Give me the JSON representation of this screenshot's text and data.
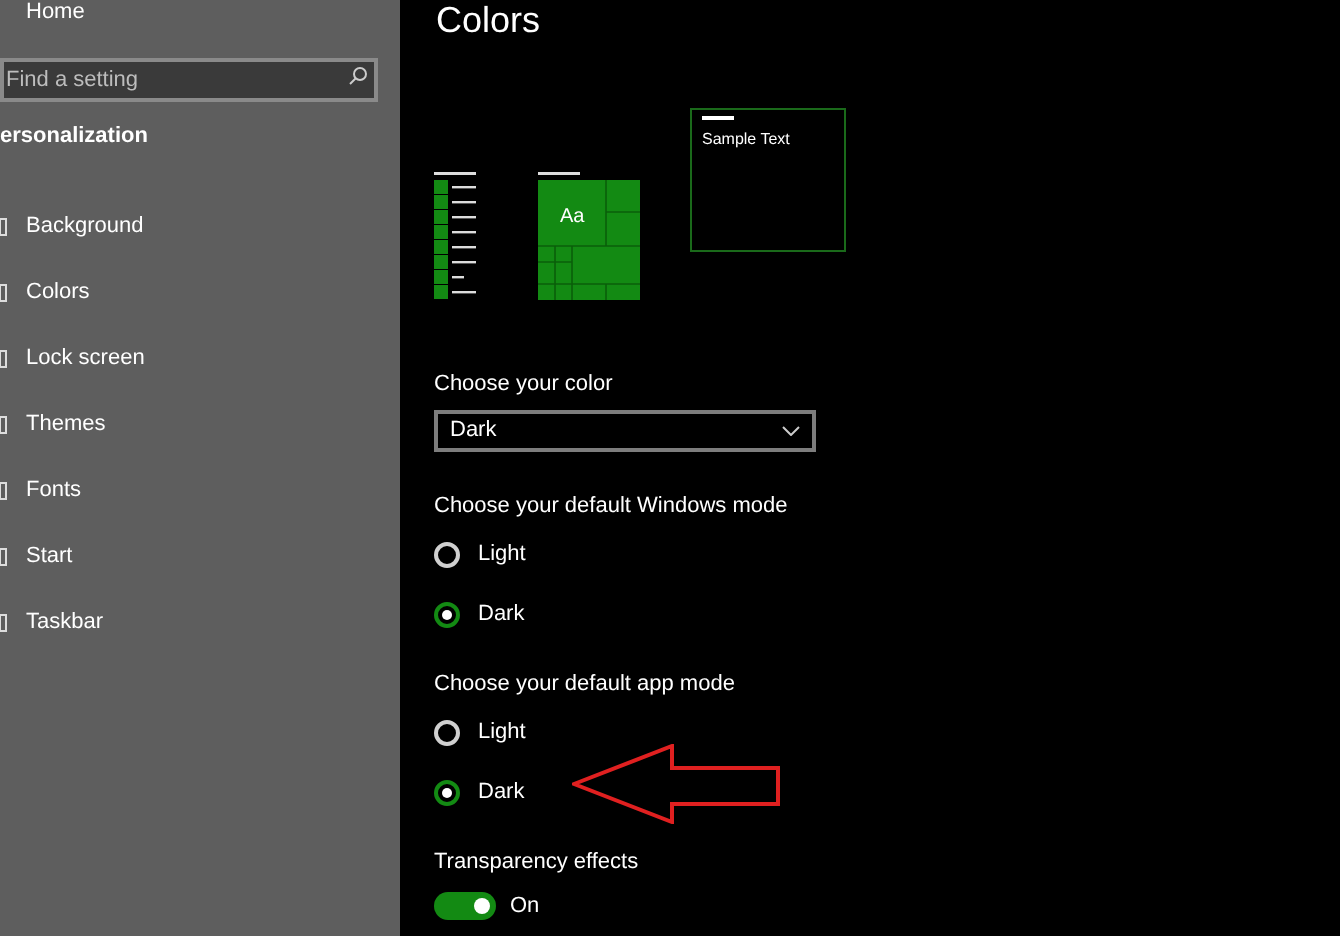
{
  "sidebar": {
    "home": "Home",
    "search": {
      "placeholder": "Find a setting"
    },
    "heading": "ersonalization",
    "items": [
      {
        "label": "Background"
      },
      {
        "label": "Colors"
      },
      {
        "label": "Lock screen"
      },
      {
        "label": "Themes"
      },
      {
        "label": "Fonts"
      },
      {
        "label": "Start"
      },
      {
        "label": "Taskbar"
      }
    ]
  },
  "main": {
    "title": "Colors",
    "preview": {
      "tile_text": "Aa",
      "sample_text": "Sample Text"
    },
    "color_label": "Choose your color",
    "color_dropdown": {
      "value": "Dark"
    },
    "groups": [
      {
        "label": "Choose your default Windows mode",
        "options": [
          {
            "label": "Light",
            "selected": false
          },
          {
            "label": "Dark",
            "selected": true
          }
        ]
      },
      {
        "label": "Choose your default app mode",
        "options": [
          {
            "label": "Light",
            "selected": false
          },
          {
            "label": "Dark",
            "selected": true
          }
        ]
      }
    ],
    "transparency": {
      "label": "Transparency effects",
      "on": true,
      "state_text": "On"
    }
  }
}
